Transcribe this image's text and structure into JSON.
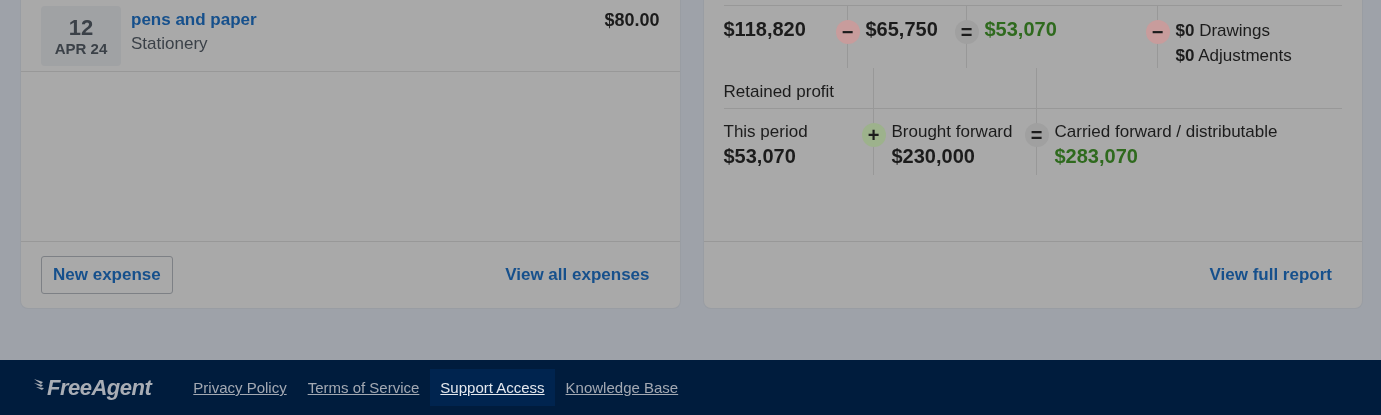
{
  "expenses_card": {
    "expenses": [
      {
        "day": "12",
        "month_year": "APR 24",
        "description": "pens and paper",
        "category": "Stationery",
        "amount": "$80.00"
      }
    ],
    "new_button": "New expense",
    "view_all_link": "View all expenses"
  },
  "profit_card": {
    "summary": [
      {
        "value": "$118,820",
        "highlighted": false
      },
      {
        "sign": {
          "kind": "minus",
          "symbol": "−"
        },
        "value": "$65,750",
        "highlighted": false
      },
      {
        "sign": {
          "kind": "equals",
          "symbol": "="
        },
        "value": "$53,070",
        "highlighted": true
      },
      {
        "sign": {
          "kind": "minus",
          "symbol": "−"
        },
        "lines": [
          "**$0** Drawings",
          "**$0** Adjustments"
        ]
      }
    ],
    "retained_title": "Retained profit",
    "retained": [
      {
        "label": "This period",
        "value": "$53,070",
        "highlighted": false
      },
      {
        "sign": {
          "kind": "plus",
          "symbol": "+"
        },
        "label": "Brought forward",
        "value": "$230,000",
        "highlighted": false
      },
      {
        "sign": {
          "kind": "equals",
          "symbol": "="
        },
        "label": "Carried forward / distributable",
        "value": "$283,070",
        "highlighted": true
      }
    ],
    "report_link": "View full report"
  },
  "footer": {
    "logo": "FreeAgent",
    "links": [
      {
        "label": "Privacy Policy",
        "selected": false
      },
      {
        "label": "Terms of Service",
        "selected": false
      },
      {
        "label": "Support Access",
        "selected": true
      },
      {
        "label": "Knowledge Base",
        "selected": false
      }
    ]
  }
}
